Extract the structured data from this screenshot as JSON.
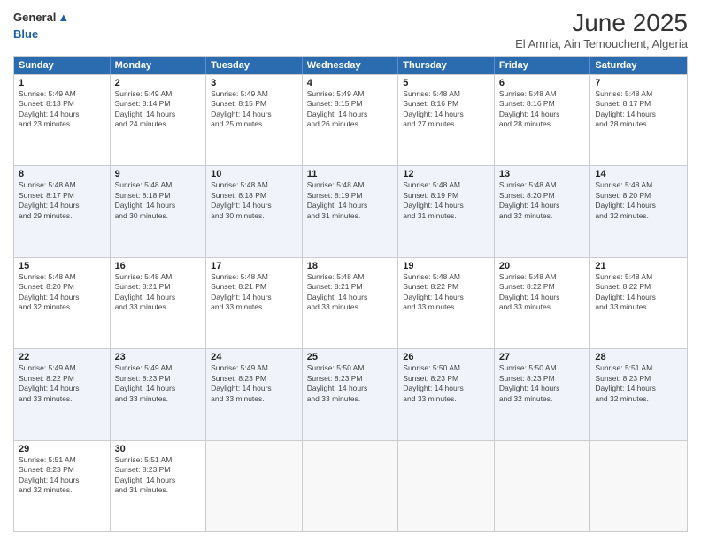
{
  "header": {
    "logo_line1": "General",
    "logo_line2": "Blue",
    "month": "June 2025",
    "location": "El Amria, Ain Temouchent, Algeria"
  },
  "weekdays": [
    "Sunday",
    "Monday",
    "Tuesday",
    "Wednesday",
    "Thursday",
    "Friday",
    "Saturday"
  ],
  "rows": [
    [
      {
        "day": "1",
        "info": "Sunrise: 5:49 AM\nSunset: 8:13 PM\nDaylight: 14 hours\nand 23 minutes."
      },
      {
        "day": "2",
        "info": "Sunrise: 5:49 AM\nSunset: 8:14 PM\nDaylight: 14 hours\nand 24 minutes."
      },
      {
        "day": "3",
        "info": "Sunrise: 5:49 AM\nSunset: 8:15 PM\nDaylight: 14 hours\nand 25 minutes."
      },
      {
        "day": "4",
        "info": "Sunrise: 5:49 AM\nSunset: 8:15 PM\nDaylight: 14 hours\nand 26 minutes."
      },
      {
        "day": "5",
        "info": "Sunrise: 5:48 AM\nSunset: 8:16 PM\nDaylight: 14 hours\nand 27 minutes."
      },
      {
        "day": "6",
        "info": "Sunrise: 5:48 AM\nSunset: 8:16 PM\nDaylight: 14 hours\nand 28 minutes."
      },
      {
        "day": "7",
        "info": "Sunrise: 5:48 AM\nSunset: 8:17 PM\nDaylight: 14 hours\nand 28 minutes."
      }
    ],
    [
      {
        "day": "8",
        "info": "Sunrise: 5:48 AM\nSunset: 8:17 PM\nDaylight: 14 hours\nand 29 minutes."
      },
      {
        "day": "9",
        "info": "Sunrise: 5:48 AM\nSunset: 8:18 PM\nDaylight: 14 hours\nand 30 minutes."
      },
      {
        "day": "10",
        "info": "Sunrise: 5:48 AM\nSunset: 8:18 PM\nDaylight: 14 hours\nand 30 minutes."
      },
      {
        "day": "11",
        "info": "Sunrise: 5:48 AM\nSunset: 8:19 PM\nDaylight: 14 hours\nand 31 minutes."
      },
      {
        "day": "12",
        "info": "Sunrise: 5:48 AM\nSunset: 8:19 PM\nDaylight: 14 hours\nand 31 minutes."
      },
      {
        "day": "13",
        "info": "Sunrise: 5:48 AM\nSunset: 8:20 PM\nDaylight: 14 hours\nand 32 minutes."
      },
      {
        "day": "14",
        "info": "Sunrise: 5:48 AM\nSunset: 8:20 PM\nDaylight: 14 hours\nand 32 minutes."
      }
    ],
    [
      {
        "day": "15",
        "info": "Sunrise: 5:48 AM\nSunset: 8:20 PM\nDaylight: 14 hours\nand 32 minutes."
      },
      {
        "day": "16",
        "info": "Sunrise: 5:48 AM\nSunset: 8:21 PM\nDaylight: 14 hours\nand 33 minutes."
      },
      {
        "day": "17",
        "info": "Sunrise: 5:48 AM\nSunset: 8:21 PM\nDaylight: 14 hours\nand 33 minutes."
      },
      {
        "day": "18",
        "info": "Sunrise: 5:48 AM\nSunset: 8:21 PM\nDaylight: 14 hours\nand 33 minutes."
      },
      {
        "day": "19",
        "info": "Sunrise: 5:48 AM\nSunset: 8:22 PM\nDaylight: 14 hours\nand 33 minutes."
      },
      {
        "day": "20",
        "info": "Sunrise: 5:48 AM\nSunset: 8:22 PM\nDaylight: 14 hours\nand 33 minutes."
      },
      {
        "day": "21",
        "info": "Sunrise: 5:48 AM\nSunset: 8:22 PM\nDaylight: 14 hours\nand 33 minutes."
      }
    ],
    [
      {
        "day": "22",
        "info": "Sunrise: 5:49 AM\nSunset: 8:22 PM\nDaylight: 14 hours\nand 33 minutes."
      },
      {
        "day": "23",
        "info": "Sunrise: 5:49 AM\nSunset: 8:23 PM\nDaylight: 14 hours\nand 33 minutes."
      },
      {
        "day": "24",
        "info": "Sunrise: 5:49 AM\nSunset: 8:23 PM\nDaylight: 14 hours\nand 33 minutes."
      },
      {
        "day": "25",
        "info": "Sunrise: 5:50 AM\nSunset: 8:23 PM\nDaylight: 14 hours\nand 33 minutes."
      },
      {
        "day": "26",
        "info": "Sunrise: 5:50 AM\nSunset: 8:23 PM\nDaylight: 14 hours\nand 33 minutes."
      },
      {
        "day": "27",
        "info": "Sunrise: 5:50 AM\nSunset: 8:23 PM\nDaylight: 14 hours\nand 32 minutes."
      },
      {
        "day": "28",
        "info": "Sunrise: 5:51 AM\nSunset: 8:23 PM\nDaylight: 14 hours\nand 32 minutes."
      }
    ],
    [
      {
        "day": "29",
        "info": "Sunrise: 5:51 AM\nSunset: 8:23 PM\nDaylight: 14 hours\nand 32 minutes."
      },
      {
        "day": "30",
        "info": "Sunrise: 5:51 AM\nSunset: 8:23 PM\nDaylight: 14 hours\nand 31 minutes."
      },
      {
        "day": "",
        "info": ""
      },
      {
        "day": "",
        "info": ""
      },
      {
        "day": "",
        "info": ""
      },
      {
        "day": "",
        "info": ""
      },
      {
        "day": "",
        "info": ""
      }
    ]
  ]
}
